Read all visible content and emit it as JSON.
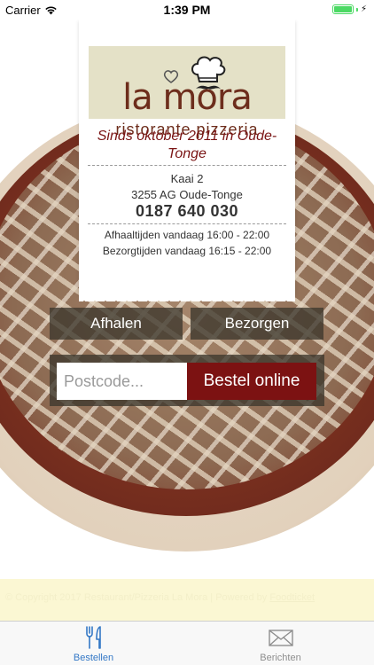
{
  "status_bar": {
    "carrier": "Carrier",
    "time": "1:39 PM",
    "battery_level": 1.0,
    "wifi_icon": "wifi-icon",
    "battery_icon": "battery-icon"
  },
  "receipt": {
    "logo": {
      "name": "la mora",
      "subtitle": "ristorante pizzeria"
    },
    "tagline": "Sinds oktober 2011 in Oude-Tonge",
    "address_line1": "Kaai 2",
    "address_line2": "3255 AG Oude-Tonge",
    "phone": "0187 640 030",
    "pickup_hours": "Afhaaltijden vandaag 16:00 - 22:00",
    "delivery_hours": "Bezorgtijden vandaag 16:15 - 22:00"
  },
  "order": {
    "pickup_label": "Afhalen",
    "delivery_label": "Bezorgen",
    "postcode_placeholder": "Postcode...",
    "postcode_value": "",
    "order_button_label": "Bestel online"
  },
  "footer": {
    "copyright": "© Copyright 2017 Restaurant/Pizzeria La Mora | Powered by ",
    "powered_link": "Foodticket"
  },
  "tab_bar": {
    "tabs": [
      {
        "label": "Bestellen",
        "icon": "fork-knife-icon",
        "active": true
      },
      {
        "label": "Berichten",
        "icon": "envelope-icon",
        "active": false
      }
    ]
  },
  "colors": {
    "accent_tab": "#3478c6",
    "brand_red": "#7c1212",
    "logo_brown": "#6d2d1c",
    "battery_green": "#4cd964"
  }
}
